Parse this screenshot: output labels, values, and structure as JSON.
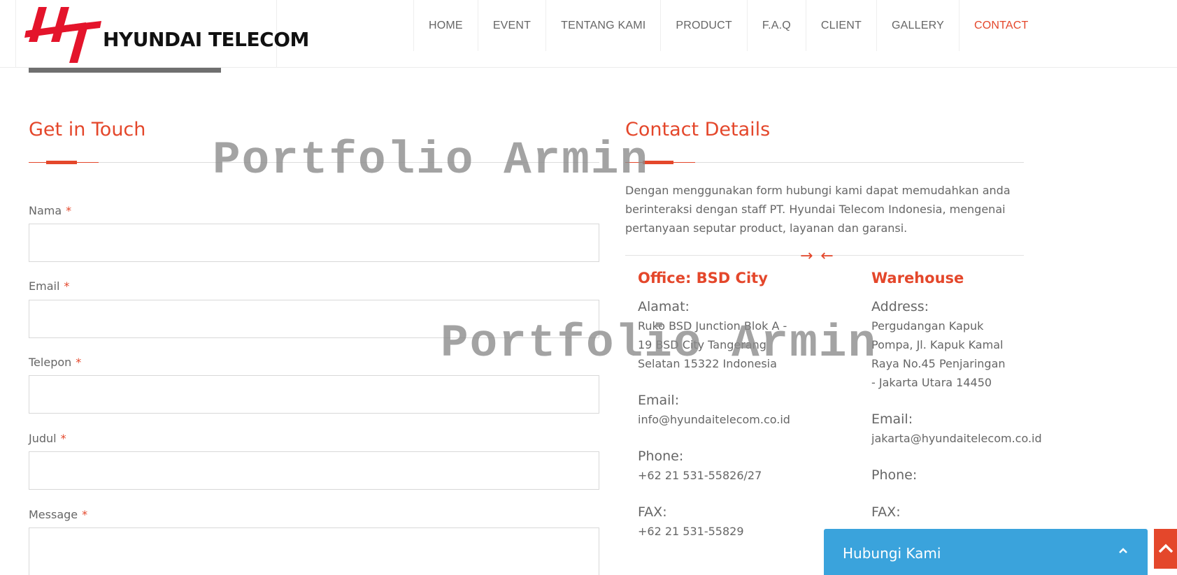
{
  "header": {
    "logo_text": "HYUNDAI TELECOM",
    "nav": [
      {
        "label": "HOME"
      },
      {
        "label": "EVENT"
      },
      {
        "label": "TENTANG KAMI"
      },
      {
        "label": "PRODUCT"
      },
      {
        "label": "F.A.Q"
      },
      {
        "label": "CLIENT"
      },
      {
        "label": "GALLERY"
      },
      {
        "label": "CONTACT",
        "active": true
      }
    ]
  },
  "form": {
    "title": "Get in Touch",
    "required_mark": "*",
    "fields": {
      "nama": {
        "label": "Nama",
        "value": ""
      },
      "email": {
        "label": "Email",
        "value": ""
      },
      "telepon": {
        "label": "Telepon",
        "value": ""
      },
      "judul": {
        "label": "Judul",
        "value": ""
      },
      "message": {
        "label": "Message",
        "value": ""
      }
    }
  },
  "details": {
    "title": "Contact Details",
    "intro": "Dengan menggunakan form hubungi kami dapat memudahkan anda berinteraksi dengan staff PT. Hyundai Telecom Indonesia, mengenai pertanyaan seputar product, layanan dan garansi.",
    "divider_arrows": "→ ←",
    "office": {
      "title": "Office: BSD City",
      "address_label": "Alamat:",
      "address": "Ruko BSD Junction Blok A - 19 BSD City Tangerang Selatan 15322 Indonesia",
      "email_label": "Email:",
      "email": "info@hyundaitelecom.co.id",
      "phone_label": "Phone:",
      "phone": "+62 21 531-55826/27",
      "fax_label": "FAX:",
      "fax": "+62 21 531-55829"
    },
    "warehouse": {
      "title": "Warehouse",
      "address_label": "Address:",
      "address": "Pergudangan Kapuk Pompa, Jl. Kapuk Kamal Raya No.45 Penjaringan - Jakarta Utara 14450",
      "email_label": "Email:",
      "email": "jakarta@hyundaitelecom.co.id",
      "phone_label": "Phone:",
      "fax_label": "FAX:"
    }
  },
  "watermark": "Portfolio Armin",
  "chat": {
    "label": "Hubungi Kami"
  },
  "colors": {
    "accent": "#e4472b",
    "chat": "#3aa3dc"
  }
}
